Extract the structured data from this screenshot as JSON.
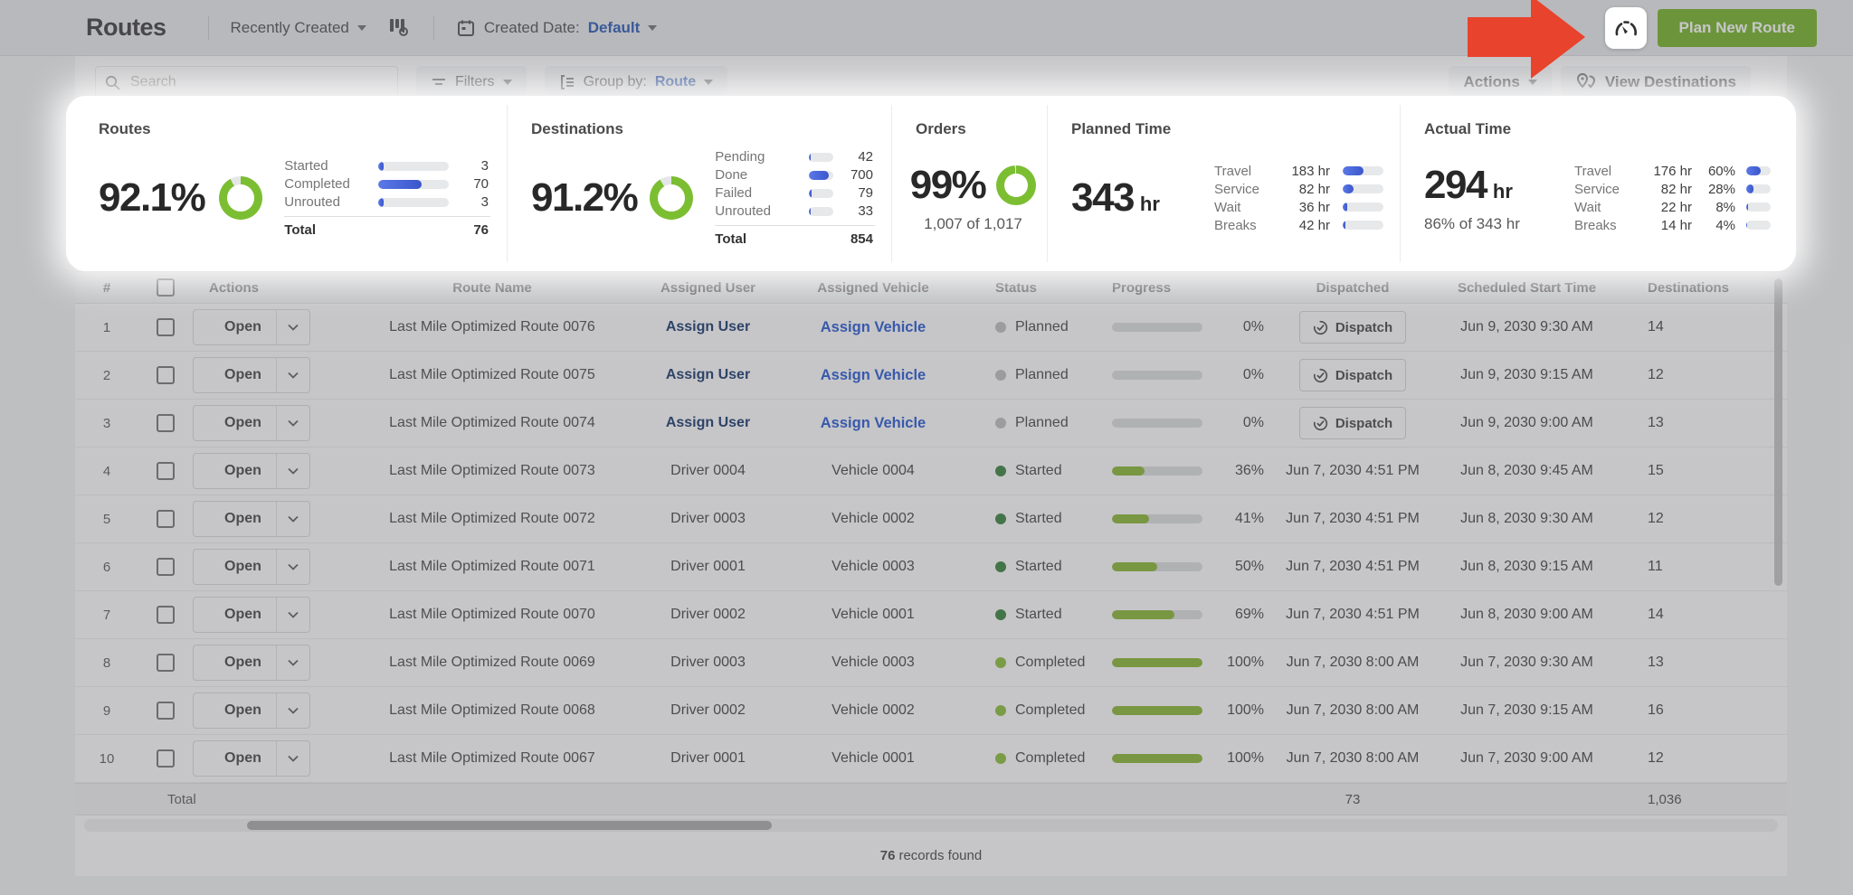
{
  "topbar": {
    "title": "Routes",
    "sort_label": "Recently Created",
    "created_date_label": "Created Date:",
    "created_date_value": "Default",
    "plan_new_route_label": "Plan New Route"
  },
  "toolbar": {
    "search_placeholder": "Search",
    "filters_label": "Filters",
    "group_by_label": "Group by:",
    "group_by_value": "Route",
    "actions_label": "Actions",
    "view_destinations_label": "View Destinations"
  },
  "stats": {
    "routes": {
      "title": "Routes",
      "pct_text": "92.1%",
      "pct": 92.1,
      "rows": [
        {
          "label": "Started",
          "value": "3",
          "fill": 8
        },
        {
          "label": "Completed",
          "value": "70",
          "fill": 62
        },
        {
          "label": "Unrouted",
          "value": "3",
          "fill": 8
        }
      ],
      "total_label": "Total",
      "total_value": "76"
    },
    "destinations": {
      "title": "Destinations",
      "pct_text": "91.2%",
      "pct": 91.2,
      "rows": [
        {
          "label": "Pending",
          "value": "42",
          "fill": 8
        },
        {
          "label": "Done",
          "value": "700",
          "fill": 80
        },
        {
          "label": "Failed",
          "value": "79",
          "fill": 9
        },
        {
          "label": "Unrouted",
          "value": "33",
          "fill": 6
        }
      ],
      "total_label": "Total",
      "total_value": "854"
    },
    "orders": {
      "title": "Orders",
      "pct_text": "99%",
      "pct": 99,
      "subtitle": "1,007 of 1,017"
    },
    "planned_time": {
      "title": "Planned Time",
      "value": "343",
      "unit": "hr",
      "rows": [
        {
          "label": "Travel",
          "value": "183 hr",
          "fill": 50
        },
        {
          "label": "Service",
          "value": "82 hr",
          "fill": 27
        },
        {
          "label": "Wait",
          "value": "36 hr",
          "fill": 11
        },
        {
          "label": "Breaks",
          "value": "42 hr",
          "fill": 7
        }
      ]
    },
    "actual_time": {
      "title": "Actual Time",
      "value": "294",
      "unit": "hr",
      "subtitle": "86% of 343 hr",
      "rows": [
        {
          "label": "Travel",
          "value": "176 hr",
          "pct": "60%",
          "fill": 60
        },
        {
          "label": "Service",
          "value": "82 hr",
          "pct": "28%",
          "fill": 28
        },
        {
          "label": "Wait",
          "value": "22 hr",
          "pct": "8%",
          "fill": 8
        },
        {
          "label": "Breaks",
          "value": "14 hr",
          "pct": "4%",
          "fill": 4
        }
      ]
    }
  },
  "table": {
    "headers": {
      "num": "#",
      "actions": "Actions",
      "route_name": "Route Name",
      "assigned_user": "Assigned User",
      "assigned_vehicle": "Assigned Vehicle",
      "status": "Status",
      "progress": "Progress",
      "dispatched": "Dispatched",
      "scheduled": "Scheduled Start Time",
      "destinations": "Destinations"
    },
    "open_label": "Open",
    "dispatch_label": "Dispatch",
    "rows": [
      {
        "num": "1",
        "route": "Last Mile Optimized Route 0076",
        "user": "Assign User",
        "user_is_link": true,
        "vehicle": "Assign Vehicle",
        "vehicle_is_link": true,
        "status": "Planned",
        "status_type": "planned",
        "progress": 0,
        "progress_label": "0%",
        "dispatch_button": true,
        "dispatched": "",
        "scheduled": "Jun 9, 2030 9:30 AM",
        "destinations": "14"
      },
      {
        "num": "2",
        "route": "Last Mile Optimized Route 0075",
        "user": "Assign User",
        "user_is_link": true,
        "vehicle": "Assign Vehicle",
        "vehicle_is_link": true,
        "status": "Planned",
        "status_type": "planned",
        "progress": 0,
        "progress_label": "0%",
        "dispatch_button": true,
        "dispatched": "",
        "scheduled": "Jun 9, 2030 9:15 AM",
        "destinations": "12"
      },
      {
        "num": "3",
        "route": "Last Mile Optimized Route 0074",
        "user": "Assign User",
        "user_is_link": true,
        "vehicle": "Assign Vehicle",
        "vehicle_is_link": true,
        "status": "Planned",
        "status_type": "planned",
        "progress": 0,
        "progress_label": "0%",
        "dispatch_button": true,
        "dispatched": "",
        "scheduled": "Jun 9, 2030 9:00 AM",
        "destinations": "13"
      },
      {
        "num": "4",
        "route": "Last Mile Optimized Route 0073",
        "user": "Driver 0004",
        "user_is_link": false,
        "vehicle": "Vehicle 0004",
        "vehicle_is_link": false,
        "status": "Started",
        "status_type": "started",
        "progress": 36,
        "progress_label": "36%",
        "dispatch_button": false,
        "dispatched": "Jun 7, 2030 4:51 PM",
        "scheduled": "Jun 8, 2030 9:45 AM",
        "destinations": "15"
      },
      {
        "num": "5",
        "route": "Last Mile Optimized Route 0072",
        "user": "Driver 0003",
        "user_is_link": false,
        "vehicle": "Vehicle 0002",
        "vehicle_is_link": false,
        "status": "Started",
        "status_type": "started",
        "progress": 41,
        "progress_label": "41%",
        "dispatch_button": false,
        "dispatched": "Jun 7, 2030 4:51 PM",
        "scheduled": "Jun 8, 2030 9:30 AM",
        "destinations": "12"
      },
      {
        "num": "6",
        "route": "Last Mile Optimized Route 0071",
        "user": "Driver 0001",
        "user_is_link": false,
        "vehicle": "Vehicle 0003",
        "vehicle_is_link": false,
        "status": "Started",
        "status_type": "started",
        "progress": 50,
        "progress_label": "50%",
        "dispatch_button": false,
        "dispatched": "Jun 7, 2030 4:51 PM",
        "scheduled": "Jun 8, 2030 9:15 AM",
        "destinations": "11"
      },
      {
        "num": "7",
        "route": "Last Mile Optimized Route 0070",
        "user": "Driver 0002",
        "user_is_link": false,
        "vehicle": "Vehicle 0001",
        "vehicle_is_link": false,
        "status": "Started",
        "status_type": "started",
        "progress": 69,
        "progress_label": "69%",
        "dispatch_button": false,
        "dispatched": "Jun 7, 2030 4:51 PM",
        "scheduled": "Jun 8, 2030 9:00 AM",
        "destinations": "14"
      },
      {
        "num": "8",
        "route": "Last Mile Optimized Route 0069",
        "user": "Driver 0003",
        "user_is_link": false,
        "vehicle": "Vehicle 0003",
        "vehicle_is_link": false,
        "status": "Completed",
        "status_type": "completed",
        "progress": 100,
        "progress_label": "100%",
        "dispatch_button": false,
        "dispatched": "Jun 7, 2030 8:00 AM",
        "scheduled": "Jun 7, 2030 9:30 AM",
        "destinations": "13"
      },
      {
        "num": "9",
        "route": "Last Mile Optimized Route 0068",
        "user": "Driver 0002",
        "user_is_link": false,
        "vehicle": "Vehicle 0002",
        "vehicle_is_link": false,
        "status": "Completed",
        "status_type": "completed",
        "progress": 100,
        "progress_label": "100%",
        "dispatch_button": false,
        "dispatched": "Jun 7, 2030 8:00 AM",
        "scheduled": "Jun 7, 2030 9:15 AM",
        "destinations": "16"
      },
      {
        "num": "10",
        "route": "Last Mile Optimized Route 0067",
        "user": "Driver 0001",
        "user_is_link": false,
        "vehicle": "Vehicle 0001",
        "vehicle_is_link": false,
        "status": "Completed",
        "status_type": "completed",
        "progress": 100,
        "progress_label": "100%",
        "dispatch_button": false,
        "dispatched": "Jun 7, 2030 8:00 AM",
        "scheduled": "Jun 7, 2030 9:00 AM",
        "destinations": "12"
      }
    ],
    "total_label": "Total",
    "total_dispatched": "73",
    "total_destinations": "1,036"
  },
  "footer": {
    "records_bold": "76",
    "records_suffix": " records found"
  },
  "colors": {
    "button_green": "#6fb11c",
    "donut_green": "#7cbe32",
    "bar_blue": "#3a56cc",
    "arrow_red": "#e8432d",
    "assign_user_navy": "#0b2d66",
    "assign_vehicle_blue": "#1a4fd0",
    "status_planned": "#bcbcbc",
    "status_started": "#2e7d32",
    "status_completed": "#85bb2f",
    "progress_green": "#84b427"
  }
}
